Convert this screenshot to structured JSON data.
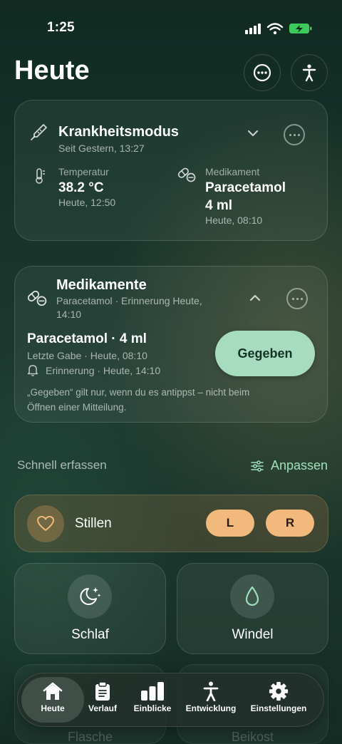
{
  "status_bar": {
    "time": "1:25"
  },
  "header": {
    "title": "Heute"
  },
  "illness": {
    "title": "Krankheitsmodus",
    "since": "Seit Gestern, 13:27",
    "temperature_label": "Temperatur",
    "temperature_value": "38.2 °C",
    "temperature_time": "Heute, 12:50",
    "medication_label": "Medikament",
    "medication_name": "Paracetamol",
    "medication_dose": "4 ml",
    "medication_time": "Heute, 08:10"
  },
  "medications": {
    "title": "Medikamente",
    "subtitle_line1": "Paracetamol · Erinnerung Heute,",
    "subtitle_line2": "14:10",
    "drug": "Paracetamol · 4 ml",
    "last_dose": "Letzte Gabe · Heute, 08:10",
    "reminder": "Erinnerung · Heute, 14:10",
    "given_button": "Gegeben",
    "note_line1": "„Gegeben“ gilt nur, wenn du es antippst – nicht beim",
    "note_line2": "Öffnen einer Mitteilung."
  },
  "quick": {
    "title": "Schnell erfassen",
    "customize": "Anpassen",
    "nursing": "Stillen",
    "left": "L",
    "right": "R",
    "sleep": "Schlaf",
    "diaper": "Windel",
    "bottle": "Flasche",
    "solids": "Beikost"
  },
  "tabs": [
    {
      "label": "Heute"
    },
    {
      "label": "Verlauf"
    },
    {
      "label": "Einblicke"
    },
    {
      "label": "Entwicklung"
    },
    {
      "label": "Einstellungen"
    }
  ],
  "colors": {
    "accent": "#9fe0bd",
    "given": "#a8dcc0",
    "side": "#f2b97c"
  }
}
